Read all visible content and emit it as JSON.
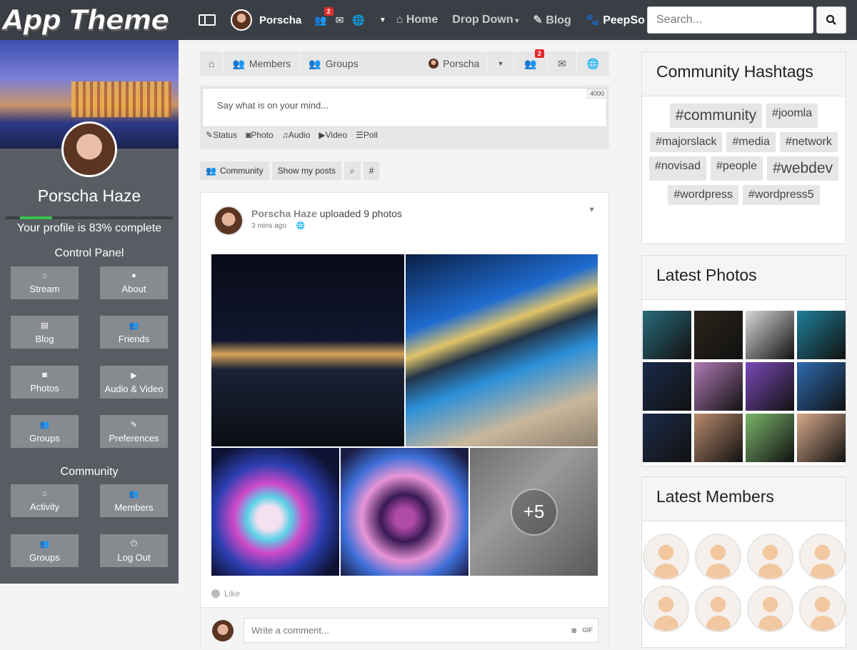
{
  "app": {
    "logo": "App Theme",
    "user_name": "Porscha",
    "friends_badge": "2",
    "nav_links": [
      "Home",
      "Drop Down",
      "Blog",
      "PeepSo"
    ],
    "search_placeholder": "Search..."
  },
  "profile": {
    "name": "Porscha Haze",
    "progress_percent": 83,
    "progress_text": "Your profile is 83% complete",
    "control_panel_title": "Control Panel",
    "control_panel": [
      "Stream",
      "About",
      "Blog",
      "Friends",
      "Photos",
      "Audio & Video",
      "Groups",
      "Preferences"
    ],
    "community_title": "Community",
    "community": [
      "Activity",
      "Members",
      "Groups",
      "Log Out"
    ]
  },
  "feed_nav": {
    "members": "Members",
    "groups": "Groups",
    "user": "Porscha",
    "friends_badge": "2"
  },
  "postbox": {
    "placeholder": "Say what is on your mind...",
    "char_limit": "4000",
    "types": [
      "Status",
      "Photo",
      "Audio",
      "Video",
      "Poll"
    ]
  },
  "filters": {
    "community": "Community",
    "show_my_posts": "Show my posts",
    "hash": "#"
  },
  "post": {
    "author": "Porscha Haze",
    "action": "uploaded 9 photos",
    "time": "3 mins ago",
    "more_count": "+5",
    "like": "Like",
    "comment_placeholder": "Write a comment...",
    "gif": "GIF"
  },
  "widgets": {
    "hashtags_title": "Community Hashtags",
    "hashtags": [
      {
        "tag": "#community",
        "size": 21
      },
      {
        "tag": "#joomla",
        "size": 16
      },
      {
        "tag": "#majorslack",
        "size": 16
      },
      {
        "tag": "#media",
        "size": 16
      },
      {
        "tag": "#network",
        "size": 16
      },
      {
        "tag": "#novisad",
        "size": 16
      },
      {
        "tag": "#people",
        "size": 16
      },
      {
        "tag": "#webdev",
        "size": 21
      },
      {
        "tag": "#wordpress",
        "size": 16
      },
      {
        "tag": "#wordpress5",
        "size": 16
      }
    ],
    "photos_title": "Latest Photos",
    "photo_colors": [
      "#2a6a7a",
      "#2b241a",
      "#d8d8d8",
      "#1f7f9a",
      "#1a2a4a",
      "#b07ab5",
      "#7a4ab8",
      "#2d6bb0",
      "#1c2a48",
      "#b88a6c",
      "#7ab56a",
      "#d7a98a"
    ],
    "members_title": "Latest Members",
    "members_count": 8
  }
}
